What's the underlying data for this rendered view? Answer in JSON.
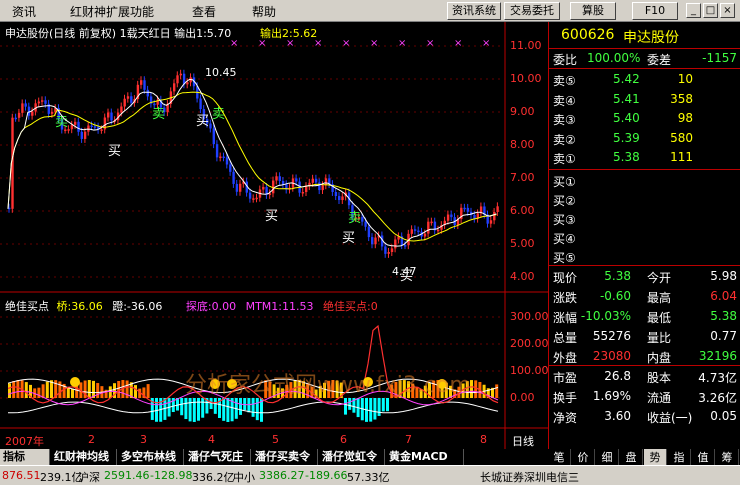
{
  "menu": [
    "资讯",
    "红财神扩展功能",
    "查看",
    "帮助"
  ],
  "toolbar": [
    "资讯系统",
    "交易委托",
    "算股",
    "F10"
  ],
  "window_controls": [
    "_",
    "□",
    "×"
  ],
  "chart": {
    "title": "申达股份(日线 前复权) 1载天红日  输出1:5.70",
    "output2": "输出2:5.62",
    "y_ticks": [
      "11.00",
      "10.00",
      "9.00",
      "8.00",
      "7.00",
      "6.00",
      "5.00",
      "4.00"
    ],
    "high_label": "10.45",
    "low_label": "4.47",
    "signal_buy": "买",
    "signal_sell": "卖",
    "indicator_name": "绝佳买点",
    "ind_bridge": "桥:36.06",
    "ind_dot": "蹬:-36.06",
    "ind_probe": "探底:0.00",
    "ind_mtm": "MTM1:11.53",
    "ind_best": "绝佳买点:0",
    "ind_y_ticks": [
      "300.00",
      "200.00",
      "100.00",
      "0.00"
    ],
    "x_labels": [
      "2007年",
      "2",
      "3",
      "4",
      "5",
      "6",
      "7",
      "8"
    ],
    "period": "日线",
    "watermark": "分析家公式网www.fxj3.com"
  },
  "quote": {
    "code": "600626",
    "name": "申达股份",
    "weibi_label": "委比",
    "weibi": "100.00%",
    "weicha_label": "委差",
    "weicha": "-1157",
    "sells": [
      {
        "label": "卖⑤",
        "price": "5.42",
        "vol": "10"
      },
      {
        "label": "卖④",
        "price": "5.41",
        "vol": "358"
      },
      {
        "label": "卖③",
        "price": "5.40",
        "vol": "98"
      },
      {
        "label": "卖②",
        "price": "5.39",
        "vol": "580"
      },
      {
        "label": "卖①",
        "price": "5.38",
        "vol": "111"
      }
    ],
    "buys": [
      "买①",
      "买②",
      "买③",
      "买④",
      "买⑤"
    ],
    "rows": [
      {
        "l1": "现价",
        "v1": "5.38",
        "l2": "今开",
        "v2": "5.98"
      },
      {
        "l1": "涨跌",
        "v1": "-0.60",
        "l2": "最高",
        "v2": "6.04"
      },
      {
        "l1": "涨幅",
        "v1": "-10.03%",
        "l2": "最低",
        "v2": "5.38"
      },
      {
        "l1": "总量",
        "v1": "55276",
        "l2": "量比",
        "v2": "0.77"
      },
      {
        "l1": "外盘",
        "v1": "23080",
        "l2": "内盘",
        "v2": "32196"
      },
      {
        "l1": "市盈",
        "v1": "26.8",
        "l2": "股本",
        "v2": "4.73亿"
      },
      {
        "l1": "换手",
        "v1": "1.69%",
        "l2": "流通",
        "v2": "3.26亿"
      },
      {
        "l1": "净资",
        "v1": "3.60",
        "l2": "收益(一)",
        "v2": "0.05"
      }
    ]
  },
  "rtabs": [
    "笔",
    "价",
    "细",
    "盘",
    "势",
    "指",
    "值",
    "筹"
  ],
  "btabs": [
    "指标",
    "红财神均线",
    "多空布林线",
    "潘仔气死庄",
    "潘仔买卖令",
    "潘仔觉虹令",
    "黄金MACD"
  ],
  "status": [
    "876.51",
    "239.1亿",
    "沪深",
    "2591.46",
    "-128.98",
    "336.2亿",
    "中小",
    "3386.27",
    "-189.66",
    "57.33亿",
    "长城证券深圳电信三"
  ],
  "colors": {
    "up": "#ff3030",
    "down": "#2040ff",
    "green": "#40ff40",
    "yellow": "#ffff00",
    "cyan": "#00ffff",
    "magenta": "#ff40ff"
  }
}
